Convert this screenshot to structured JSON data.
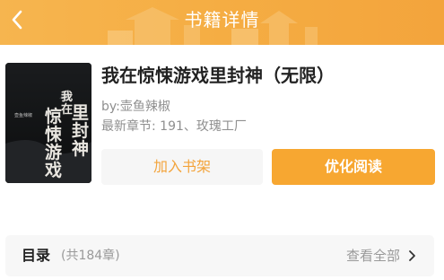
{
  "header": {
    "title": "书籍详情",
    "back_icon": "chevron-left-icon"
  },
  "book": {
    "title": "我在惊悚游戏里封神（无限）",
    "author": "by:壶鱼辣椒",
    "latest_chapter": "最新章节: 191、玫瑰工厂",
    "cover_text": "我在惊悚游戏里封神"
  },
  "actions": {
    "add_to_shelf": "加入书架",
    "optimized_read": "优化阅读"
  },
  "toc": {
    "label": "目录",
    "count": "(共184章)",
    "view_all": "查看全部",
    "chevron_icon": "chevron-right-icon"
  },
  "colors": {
    "accent": "#f7a731",
    "header_bg": "#f5ad43"
  }
}
